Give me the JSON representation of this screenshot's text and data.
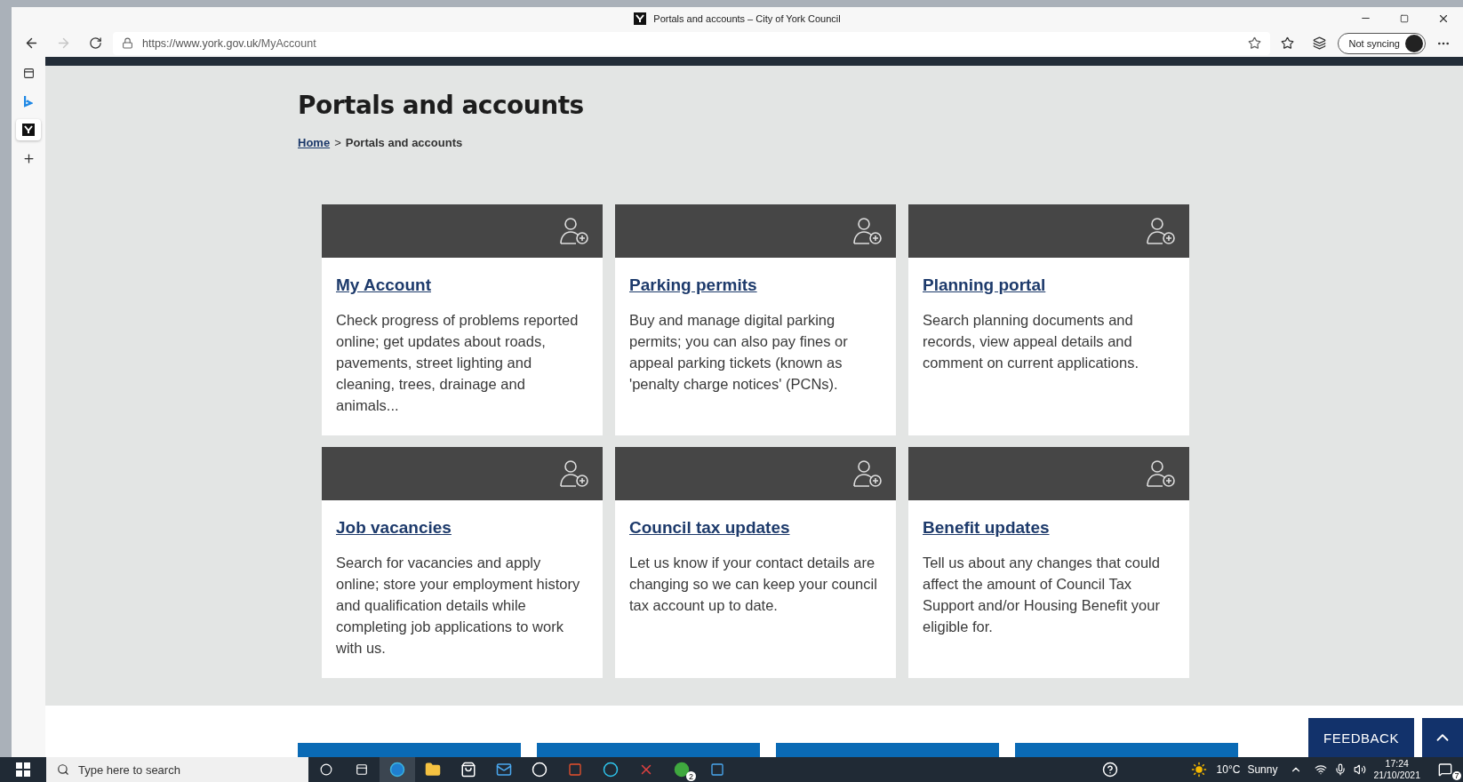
{
  "browser": {
    "tab_title": "Portals and accounts – City of York Council",
    "url_host": "https://www.york.gov.uk/",
    "url_path": "MyAccount",
    "profile_label": "Not syncing"
  },
  "page": {
    "heading": "Portals and accounts",
    "breadcrumb": [
      {
        "label": "Home",
        "kind": "link"
      },
      {
        "label": ">",
        "kind": "separator"
      },
      {
        "label": "Portals and accounts",
        "kind": "current"
      }
    ],
    "cards": [
      {
        "title": "My Account",
        "description": "Check progress of problems reported online; get updates about roads, pavements, street lighting and cleaning, trees, drainage and animals..."
      },
      {
        "title": "Parking permits",
        "description": "Buy and manage digital parking permits; you can also pay fines or appeal parking tickets (known as 'penalty charge notices' (PCNs)."
      },
      {
        "title": "Planning portal",
        "description": "Search planning documents and records, view appeal details and comment on current applications."
      },
      {
        "title": "Job vacancies",
        "description": "Search for vacancies and apply online; store your employment history and qualification details while completing job applications to work with us."
      },
      {
        "title": "Council tax updates",
        "description": "Let us know if your contact details are changing so we can keep your council tax account up to date."
      },
      {
        "title": "Benefit updates",
        "description": "Tell us about any changes that could affect the amount of Council Tax Support and/or Housing Benefit your eligible for."
      }
    ],
    "feedback_label": "FEEDBACK"
  },
  "taskbar": {
    "search_placeholder": "Type here to search",
    "xbox_badge": "2",
    "temperature": "10°C",
    "weather": "Sunny",
    "time": "17:24",
    "date": "21/10/2021",
    "notification_count": "7"
  }
}
